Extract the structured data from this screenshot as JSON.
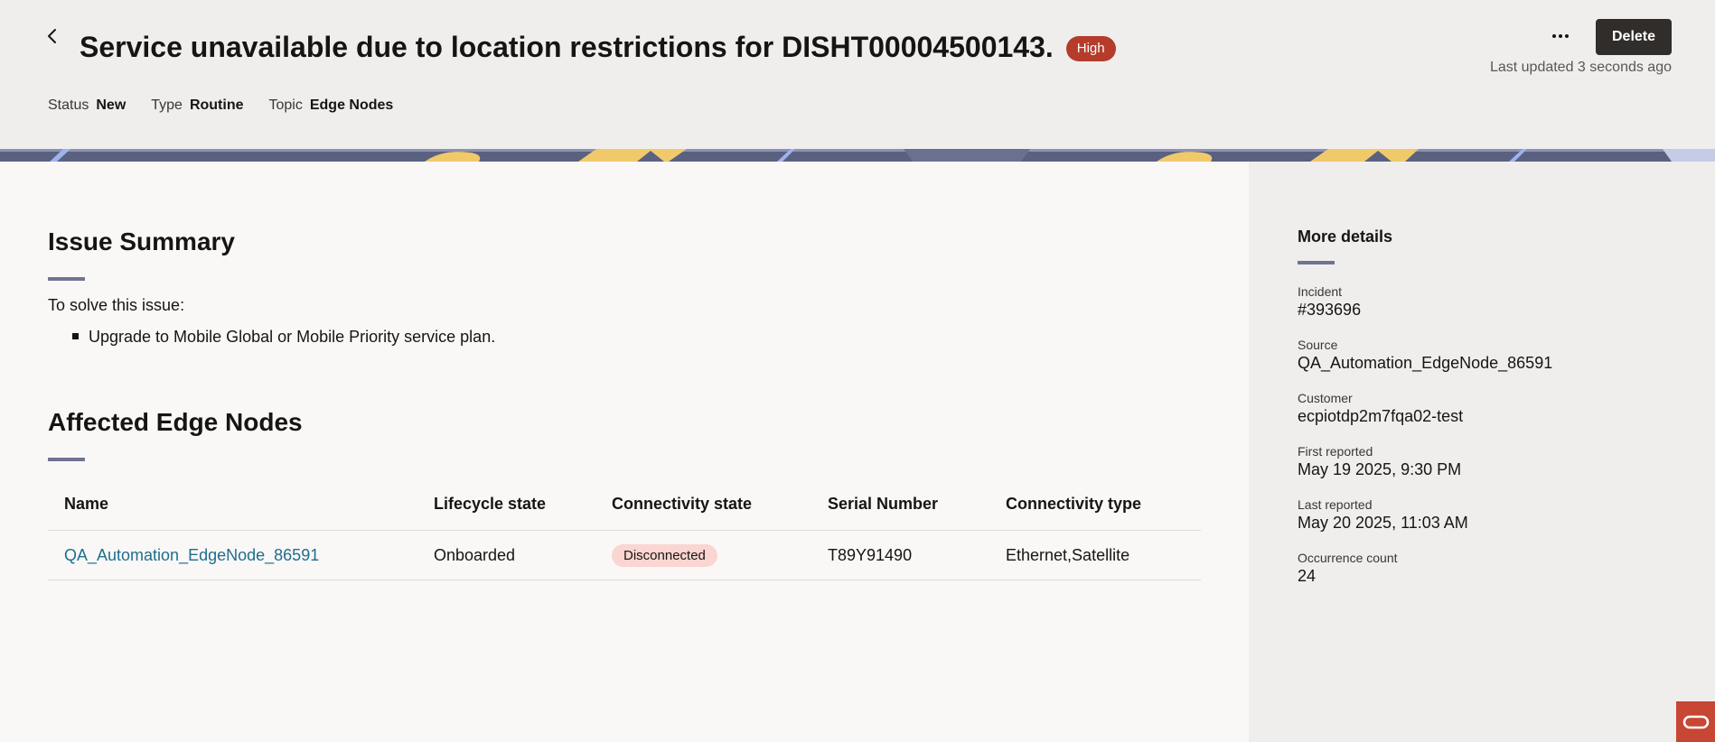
{
  "header": {
    "title": "Service unavailable due to location restrictions for DISHT00004500143.",
    "severity": "High",
    "meta": [
      {
        "label": "Status",
        "value": "New"
      },
      {
        "label": "Type",
        "value": "Routine"
      },
      {
        "label": "Topic",
        "value": "Edge Nodes"
      }
    ],
    "delete_label": "Delete",
    "last_updated": "Last updated 3 seconds ago",
    "icons": {
      "back": "chevron-left-icon",
      "more": "more-horizontal-icon"
    }
  },
  "summary": {
    "title": "Issue Summary",
    "intro": "To solve this issue:",
    "steps": [
      "Upgrade to Mobile Global or Mobile Priority service plan."
    ]
  },
  "affected": {
    "title": "Affected Edge Nodes",
    "columns": [
      "Name",
      "Lifecycle state",
      "Connectivity state",
      "Serial Number",
      "Connectivity type"
    ],
    "rows": [
      {
        "name": "QA_Automation_EdgeNode_86591",
        "lifecycle": "Onboarded",
        "connectivity_state": "Disconnected",
        "serial": "T89Y91490",
        "connectivity_type": "Ethernet,Satellite"
      }
    ]
  },
  "details": {
    "title": "More details",
    "items": [
      {
        "label": "Incident",
        "value": "#393696"
      },
      {
        "label": "Source",
        "value": "QA_Automation_EdgeNode_86591"
      },
      {
        "label": "Customer",
        "value": "ecpiotdp2m7fqa02-test"
      },
      {
        "label": "First reported",
        "value": "May 19 2025, 9:30 PM"
      },
      {
        "label": "Last reported",
        "value": "May 20 2025, 11:03 AM"
      },
      {
        "label": "Occurrence count",
        "value": "24"
      }
    ]
  },
  "colors": {
    "severity_high": "#b53b2b",
    "disconnected_pill": "#fbd5d1",
    "link": "#1f6e8c",
    "delete_button": "#312d2a",
    "oracle_brand": "#c74634"
  }
}
